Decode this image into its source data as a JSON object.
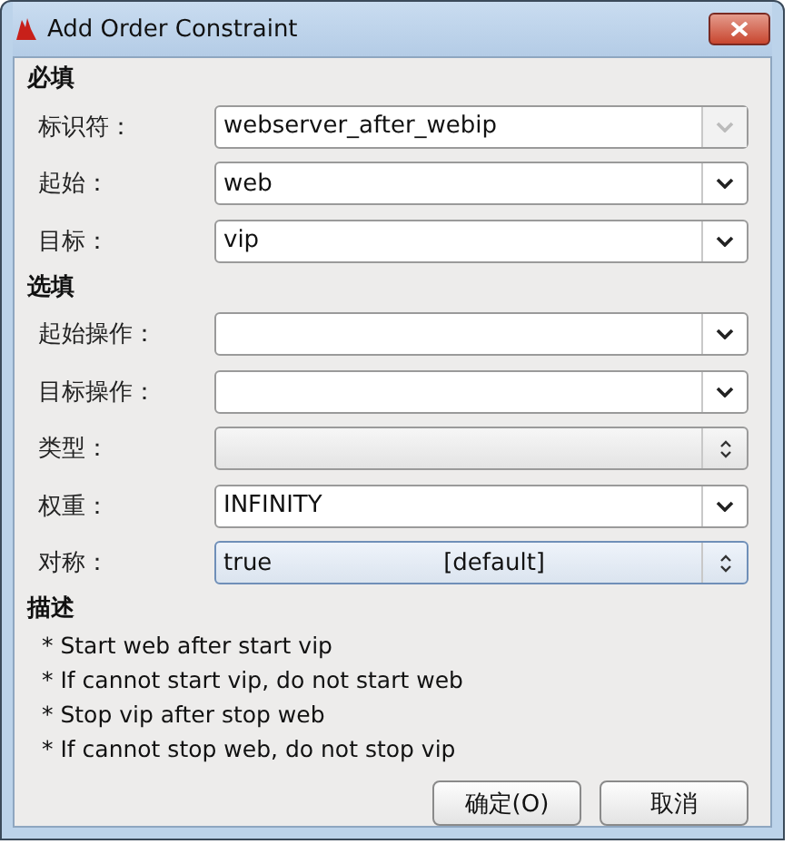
{
  "window": {
    "title": "Add Order Constraint"
  },
  "sections": [
    {
      "heading": "必填",
      "fields": [
        {
          "label": "标识符：",
          "kind": "dropdown",
          "value": "webserver_after_webip",
          "disabled": true,
          "focused": false
        },
        {
          "label": "起始：",
          "kind": "dropdown",
          "value": "web",
          "disabled": false,
          "focused": false
        },
        {
          "label": "目标：",
          "kind": "dropdown",
          "value": "vip",
          "disabled": false,
          "focused": false
        }
      ]
    },
    {
      "heading": "选填",
      "fields": [
        {
          "label": "起始操作：",
          "kind": "dropdown",
          "disabled": false,
          "focused": false
        },
        {
          "label": "目标操作：",
          "kind": "dropdown",
          "disabled": false,
          "focused": false
        },
        {
          "label": "类型：",
          "kind": "spinner",
          "disabled": false,
          "focused": false
        },
        {
          "label": "权重：",
          "kind": "dropdown",
          "value": "INFINITY",
          "disabled": false,
          "focused": false
        },
        {
          "label": "对称：",
          "kind": "spinner",
          "value": "true",
          "hint": "[default]",
          "disabled": false,
          "focused": true
        }
      ]
    }
  ],
  "description": {
    "heading": "描述",
    "lines": [
      "* Start web after start vip",
      "* If cannot start vip, do not start web",
      "* Stop vip after stop web",
      "* If cannot stop web, do not stop vip"
    ]
  },
  "buttons": [
    "确定(O)",
    "取消"
  ]
}
